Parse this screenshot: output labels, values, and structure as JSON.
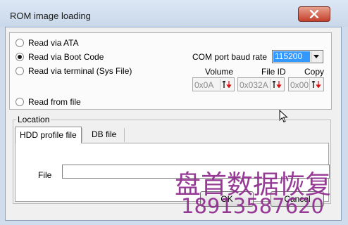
{
  "window": {
    "title": "ROM image loading"
  },
  "read_options": [
    {
      "label": "Read via ATA",
      "selected": false
    },
    {
      "label": "Read via Boot Code",
      "selected": true
    },
    {
      "label": "Read via terminal (Sys File)",
      "selected": false
    },
    {
      "label": "Read from file",
      "selected": false
    }
  ],
  "baud": {
    "label": "COM port baud rate",
    "value": "115200"
  },
  "params": {
    "volume": {
      "label": "Volume",
      "value": "0x0A"
    },
    "file_id": {
      "label": "File ID",
      "value": "0x032A"
    },
    "copy": {
      "label": "Copy",
      "value": "0x00"
    }
  },
  "location": {
    "legend": "Location",
    "tabs": [
      "HDD profile file",
      "DB file"
    ],
    "file_label": "File",
    "file_value": ""
  },
  "buttons": {
    "ok": "OK",
    "cancel": "Cancel"
  },
  "watermark": {
    "line1": "盘首数据恢复",
    "line2": "18913587620"
  }
}
